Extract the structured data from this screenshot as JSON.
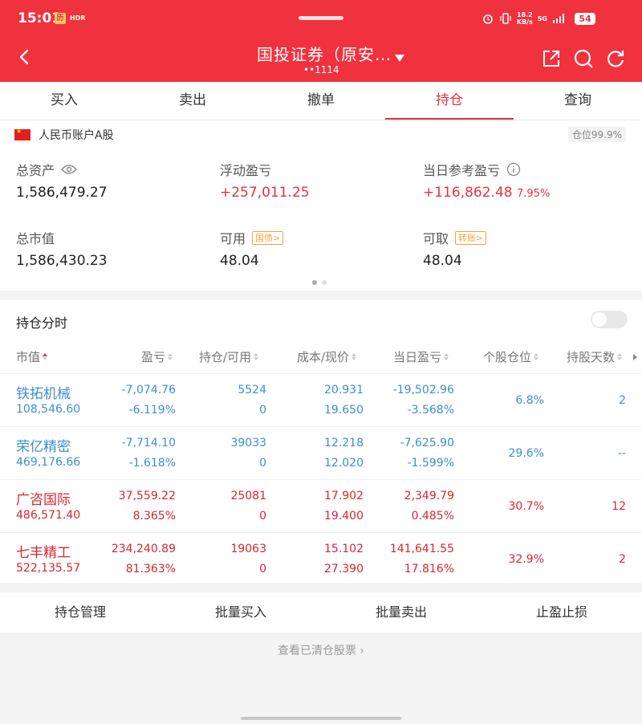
{
  "status_bar": {
    "time": "15:01",
    "app_badge_1": "历",
    "app_badge_2": "HDR",
    "speed_top": "18.2",
    "speed_bottom": "KB/s",
    "net_top": "5G",
    "net_bottom": "",
    "battery": "54"
  },
  "nav": {
    "title": "国投证券（原安…",
    "account_masked": "••1114"
  },
  "tabs": [
    {
      "label": "买入"
    },
    {
      "label": "卖出"
    },
    {
      "label": "撤单"
    },
    {
      "label": "持仓"
    },
    {
      "label": "查询"
    }
  ],
  "active_tab_index": 3,
  "account": {
    "type_label": "人民币账户A股",
    "position_ratio": "仓位99.9%",
    "total_assets_label": "总资产",
    "total_assets": "1,586,479.27",
    "floating_pnl_label": "浮动盈亏",
    "floating_pnl": "+257,011.25",
    "today_pnl_label": "当日参考盈亏",
    "today_pnl": "+116,862.48",
    "today_pnl_pct": "7.95%",
    "market_value_label": "总市值",
    "market_value": "1,586,430.23",
    "available_label": "可用",
    "available_tag": "国债>",
    "available": "48.04",
    "withdrawable_label": "可取",
    "withdrawable_tag": "转账>",
    "withdrawable": "48.04"
  },
  "holdings": {
    "title": "持仓分时",
    "headers": [
      "市值",
      "盈亏",
      "持仓/可用",
      "成本/现价",
      "当日盈亏",
      "个股仓位",
      "持股天数"
    ],
    "rows": [
      {
        "name": "铁拓机械",
        "market_value": "108,546.60",
        "pnl": "-7,074.76",
        "pnl_pct": "-6.119%",
        "shares": "5524",
        "available": "0",
        "cost": "20.931",
        "price": "19.650",
        "today_pnl": "-19,502.96",
        "today_pct": "-3.568%",
        "position": "6.8%",
        "days": "2",
        "color": "blue"
      },
      {
        "name": "荣亿精密",
        "market_value": "469,176.66",
        "pnl": "-7,714.10",
        "pnl_pct": "-1.618%",
        "shares": "39033",
        "available": "0",
        "cost": "12.218",
        "price": "12.020",
        "today_pnl": "-7,625.90",
        "today_pct": "-1.599%",
        "position": "29.6%",
        "days": "--",
        "color": "blue"
      },
      {
        "name": "广咨国际",
        "market_value": "486,571.40",
        "pnl": "37,559.22",
        "pnl_pct": "8.365%",
        "shares": "25081",
        "available": "0",
        "cost": "17.902",
        "price": "19.400",
        "today_pnl": "2,349.79",
        "today_pct": "0.485%",
        "position": "30.7%",
        "days": "12",
        "color": "red"
      },
      {
        "name": "七丰精工",
        "market_value": "522,135.57",
        "pnl": "234,240.89",
        "pnl_pct": "81.363%",
        "shares": "19063",
        "available": "0",
        "cost": "15.102",
        "price": "27.390",
        "today_pnl": "141,641.55",
        "today_pct": "17.816%",
        "position": "32.9%",
        "days": "2",
        "color": "red"
      }
    ]
  },
  "actions": [
    "持仓管理",
    "批量买入",
    "批量卖出",
    "止盈止损"
  ],
  "cleared_link": "查看已清仓股票"
}
